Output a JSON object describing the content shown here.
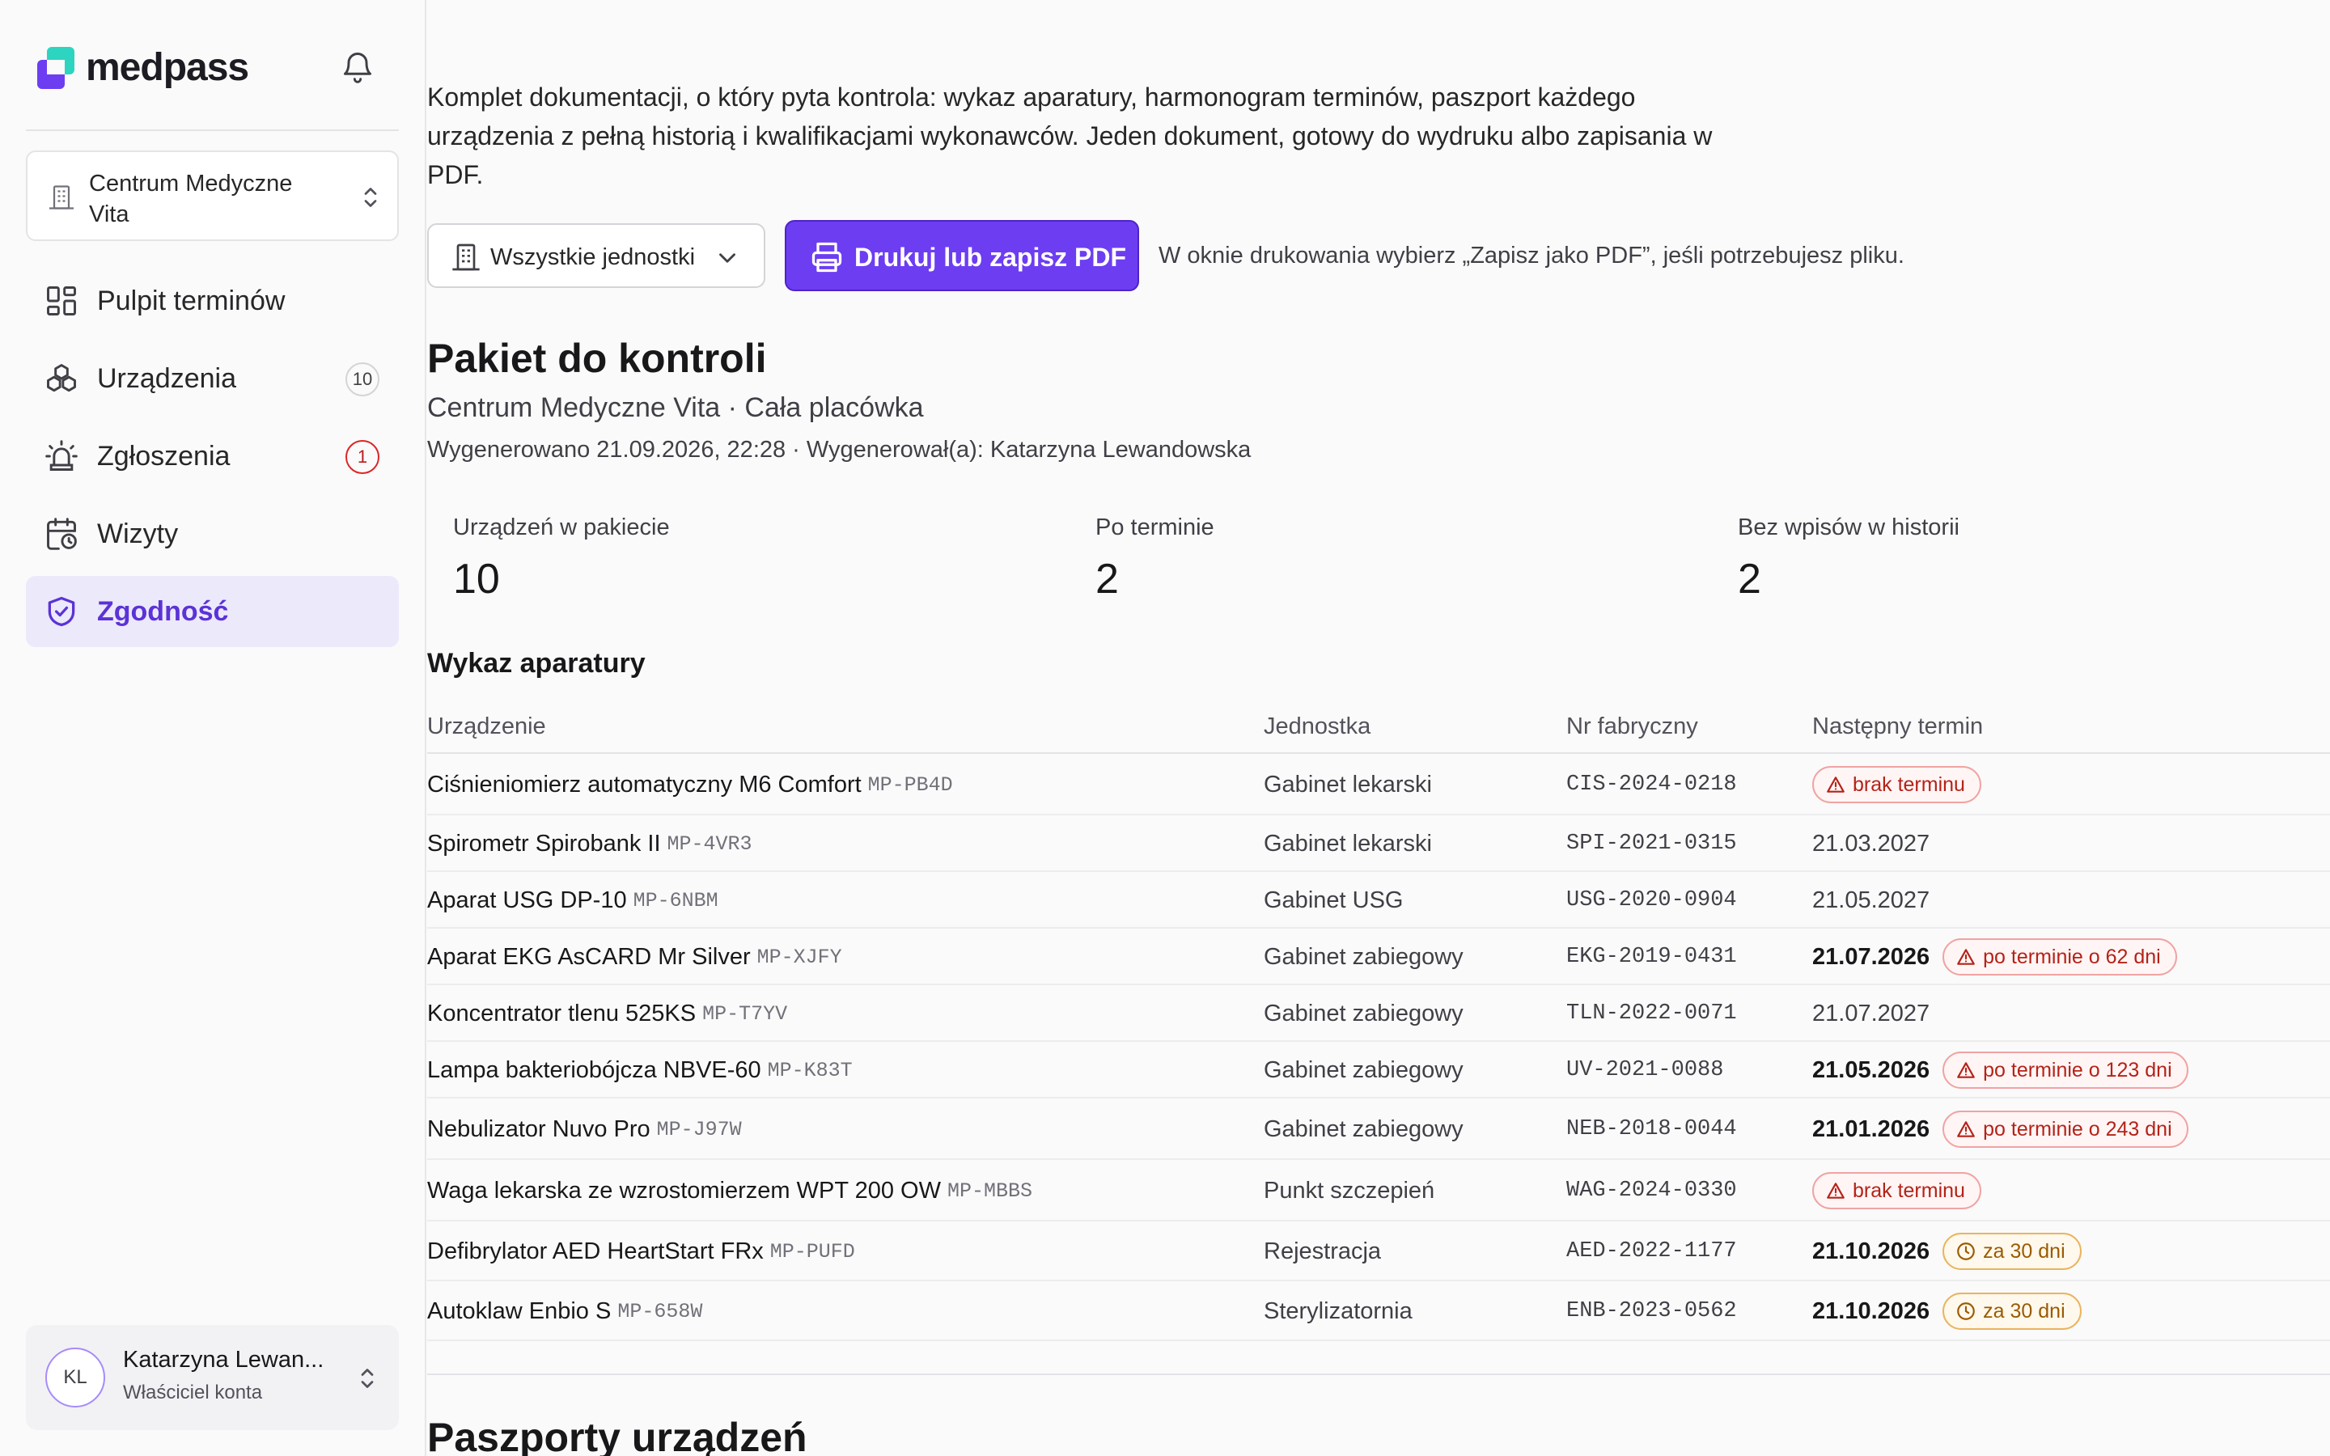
{
  "app": {
    "logo_text": "medpass"
  },
  "org": {
    "name": "Centrum Medyczne Vita"
  },
  "nav": [
    {
      "label": "Pulpit terminów",
      "icon": "dashboard-icon",
      "count": ""
    },
    {
      "label": "Urządzenia",
      "icon": "devices-icon",
      "count": "10"
    },
    {
      "label": "Zgłoszenia",
      "icon": "alarm-icon",
      "count": "1"
    },
    {
      "label": "Wizyty",
      "icon": "calendar-icon",
      "count": ""
    },
    {
      "label": "Zgodność",
      "icon": "shield-check-icon",
      "count": ""
    }
  ],
  "active_nav": "Zgodność",
  "user": {
    "initials": "KL",
    "name": "Katarzyna Lewan...",
    "role": "Właściciel konta"
  },
  "intro": "Komplet dokumentacji, o który pyta kontrola: wykaz aparatury, harmonogram terminów, paszport każdego urządzenia z pełną historią i kwalifikacjami wykonawców. Jeden dokument, gotowy do wydruku albo zapisania w PDF.",
  "toolbar": {
    "unit_select": "Wszystkie jednostki",
    "print_label": "Drukuj lub zapisz PDF",
    "hint": "W oknie drukowania wybierz „Zapisz jako PDF”, jeśli potrzebujesz pliku."
  },
  "package": {
    "title": "Pakiet do kontroli",
    "subtitle": "Centrum Medyczne Vita · Cała placówka",
    "meta": "Wygenerowano 21.09.2026, 22:28 · Wygenerował(a): Katarzyna Lewandowska"
  },
  "stats": [
    {
      "label": "Urządzeń w pakiecie",
      "value": "10"
    },
    {
      "label": "Po terminie",
      "value": "2"
    },
    {
      "label": "Bez wpisów w historii",
      "value": "2"
    }
  ],
  "list": {
    "title": "Wykaz aparatury",
    "headers": {
      "device": "Urządzenie",
      "unit": "Jednostka",
      "serial": "Nr fabryczny",
      "next": "Następny termin"
    },
    "rows": [
      {
        "device": "Ciśnieniomierz automatyczny M6 Comfort",
        "code": "MP-PB4D",
        "unit": "Gabinet lekarski",
        "serial": "CIS-2024-0218",
        "date": "",
        "badge": "brak terminu",
        "badge_type": "red"
      },
      {
        "device": "Spirometr Spirobank II",
        "code": "MP-4VR3",
        "unit": "Gabinet lekarski",
        "serial": "SPI-2021-0315",
        "date": "21.03.2027",
        "badge": "",
        "badge_type": ""
      },
      {
        "device": "Aparat USG DP-10",
        "code": "MP-6NBM",
        "unit": "Gabinet USG",
        "serial": "USG-2020-0904",
        "date": "21.05.2027",
        "badge": "",
        "badge_type": ""
      },
      {
        "device": "Aparat EKG AsCARD Mr Silver",
        "code": "MP-XJFY",
        "unit": "Gabinet zabiegowy",
        "serial": "EKG-2019-0431",
        "date": "21.07.2026",
        "badge": "po terminie o 62 dni",
        "badge_type": "red"
      },
      {
        "device": "Koncentrator tlenu 525KS",
        "code": "MP-T7YV",
        "unit": "Gabinet zabiegowy",
        "serial": "TLN-2022-0071",
        "date": "21.07.2027",
        "badge": "",
        "badge_type": ""
      },
      {
        "device": "Lampa bakteriobójcza NBVE-60",
        "code": "MP-K83T",
        "unit": "Gabinet zabiegowy",
        "serial": "UV-2021-0088",
        "date": "21.05.2026",
        "badge": "po terminie o 123 dni",
        "badge_type": "red"
      },
      {
        "device": "Nebulizator Nuvo Pro",
        "code": "MP-J97W",
        "unit": "Gabinet zabiegowy",
        "serial": "NEB-2018-0044",
        "date": "21.01.2026",
        "badge": "po terminie o 243 dni",
        "badge_type": "red"
      },
      {
        "device": "Waga lekarska ze wzrostomierzem WPT 200 OW",
        "code": "MP-MBBS",
        "unit": "Punkt szczepień",
        "serial": "WAG-2024-0330",
        "date": "",
        "badge": "brak terminu",
        "badge_type": "red"
      },
      {
        "device": "Defibrylator AED HeartStart FRx",
        "code": "MP-PUFD",
        "unit": "Rejestracja",
        "serial": "AED-2022-1177",
        "date": "21.10.2026",
        "badge": "za 30 dni",
        "badge_type": "amber"
      },
      {
        "device": "Autoklaw Enbio S",
        "code": "MP-658W",
        "unit": "Sterylizatornia",
        "serial": "ENB-2023-0562",
        "date": "21.10.2026",
        "badge": "za 30 dni",
        "badge_type": "amber"
      }
    ]
  },
  "passports": {
    "title": "Paszporty urządzeń"
  },
  "colors": {
    "accent": "#6d3df2",
    "active_bg": "#ece9fb",
    "danger": "#b42318",
    "warning": "#9a5b00"
  }
}
